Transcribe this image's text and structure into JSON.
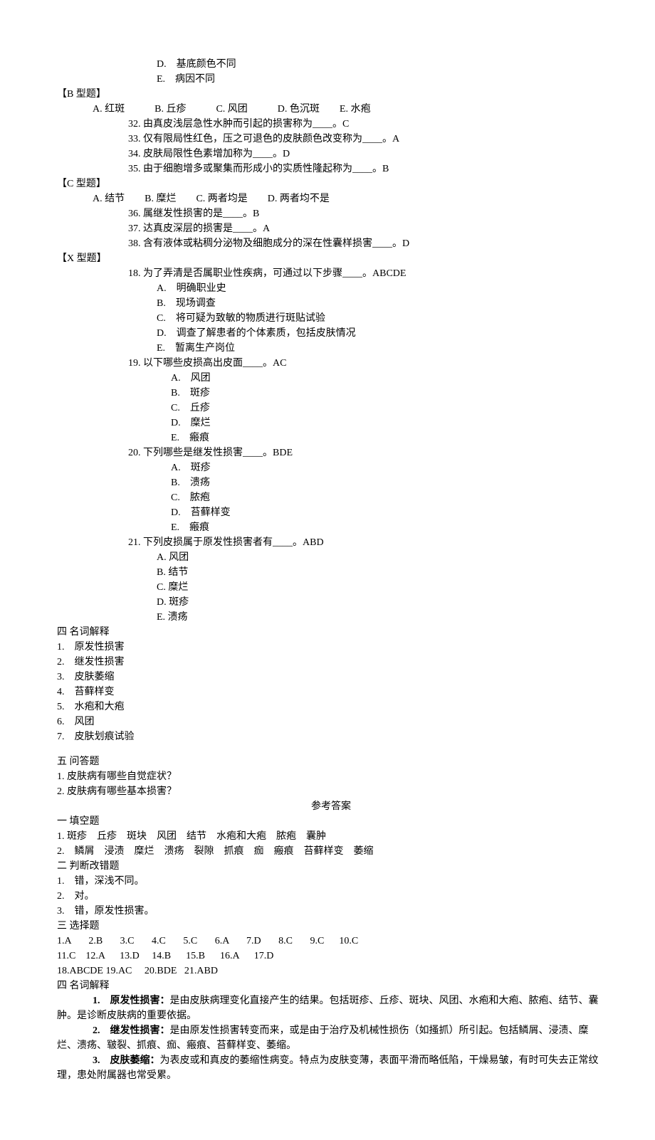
{
  "top_options": {
    "D": "D.　基底颜色不同",
    "E": "E.　病因不同"
  },
  "b_type": {
    "header": "【B 型题】",
    "choices": "A. 红斑　　　B. 丘疹　　　C. 风团　　　D. 色沉斑　　E. 水疱",
    "q32": "32.  由真皮浅层急性水肿而引起的损害称为____。C",
    "q33": "33.  仅有限局性红色，压之可退色的皮肤颜色改变称为____。A",
    "q34": "34.  皮肤局限性色素增加称为____。D",
    "q35": "35.  由于细胞增多或聚集而形成小的实质性隆起称为____。B"
  },
  "c_type": {
    "header": "【C 型题】",
    "choices": "A. 结节　　B. 糜烂　　C. 两者均是　　D. 两者均不是",
    "q36": "36.  属继发性损害的是____。B",
    "q37": "37.  达真皮深层的损害是____。A",
    "q38": "38.  含有液体或粘稠分泌物及细胞成分的深在性囊样损害____。D"
  },
  "x_type": {
    "header": "【X 型题】",
    "q18": {
      "stem": "18.  为了弄清是否属职业性疾病，可通过以下步骤____。ABCDE",
      "A": "A.　明确职业史",
      "B": "B.　现场调查",
      "C": "C.　将可疑为致敏的物质进行斑贴试验",
      "D": "D.　调查了解患者的个体素质，包括皮肤情况",
      "E": "E.　暂离生产岗位"
    },
    "q19": {
      "stem": "19.  以下哪些皮损高出皮面____。AC",
      "A": "A.　风团",
      "B": "B.　斑疹",
      "C": "C.　丘疹",
      "D": "D.　糜烂",
      "E": "E.　瘢痕"
    },
    "q20": {
      "stem": "20.  下列哪些是继发性损害____。BDE",
      "A": "A.　斑疹",
      "B": "B.　溃疡",
      "C": "C.　脓疱",
      "D": "D.　苔藓样变",
      "E": "E.　瘢痕"
    },
    "q21": {
      "stem": "21. 下列皮损属于原发性损害者有____。ABD",
      "A": "A. 风团",
      "B": "B. 结节",
      "C": "C. 糜烂",
      "D": "D. 斑疹",
      "E": "E. 溃疡"
    }
  },
  "terms": {
    "header": "四 名词解释",
    "t1": "1.　原发性损害",
    "t2": "2.　继发性损害",
    "t3": "3.　皮肤萎缩",
    "t4": "4.　苔藓样变",
    "t5": "5.　水疱和大疱",
    "t6": "6.　风团",
    "t7": "7.　皮肤划痕试验"
  },
  "qa": {
    "header": "五 问答题",
    "q1": "1.  皮肤病有哪些自觉症状？",
    "q2": "2.  皮肤病有哪些基本损害？"
  },
  "answers_title": "参考答案",
  "fill": {
    "header": "一 填空题",
    "a1": "1.  斑疹　丘疹　斑块　风团　结节　水疱和大疱　脓疱　囊肿",
    "a2": "2.　鳞屑　浸渍　糜烂　溃疡　裂隙　抓痕　痂　瘢痕　苔藓样变　萎缩"
  },
  "judge": {
    "header": "二 判断改错题",
    "j1": "1.　错，深浅不同。",
    "j2": "2.　对。",
    "j3": "3.　错，原发性损害。"
  },
  "choice_ans": {
    "header": "三 选择题",
    "row1": "1.A       2.B       3.C       4.C       5.C       6.A       7.D       8.C       9.C      10.C",
    "row2": "11.C    12.A      13.D     14.B      15.B      16.A      17.D",
    "row3": "18.ABCDE 19.AC     20.BDE   21.ABD"
  },
  "term_ans": {
    "header": "四 名词解释",
    "a1_label": "1.　原发性损害：",
    "a1_body": "是由皮肤病理变化直接产生的结果。包括斑疹、丘疹、斑块、风团、水疱和大疱、脓疱、结节、囊肿。是诊断皮肤病的重要依据。",
    "a2_label": "2.　继发性损害：",
    "a2_body": "是由原发性损害转变而来，或是由于治疗及机械性损伤（如搔抓）所引起。包括鳞屑、浸渍、糜烂、溃疡、皲裂、抓痕、痂、瘢痕、苔藓样变、萎缩。",
    "a3_label": "3.　皮肤萎缩：",
    "a3_body": "为表皮或和真皮的萎缩性病变。特点为皮肤变薄，表面平滑而略低陷，干燥易皱，有时可失去正常纹理，患处附属器也常受累。"
  }
}
